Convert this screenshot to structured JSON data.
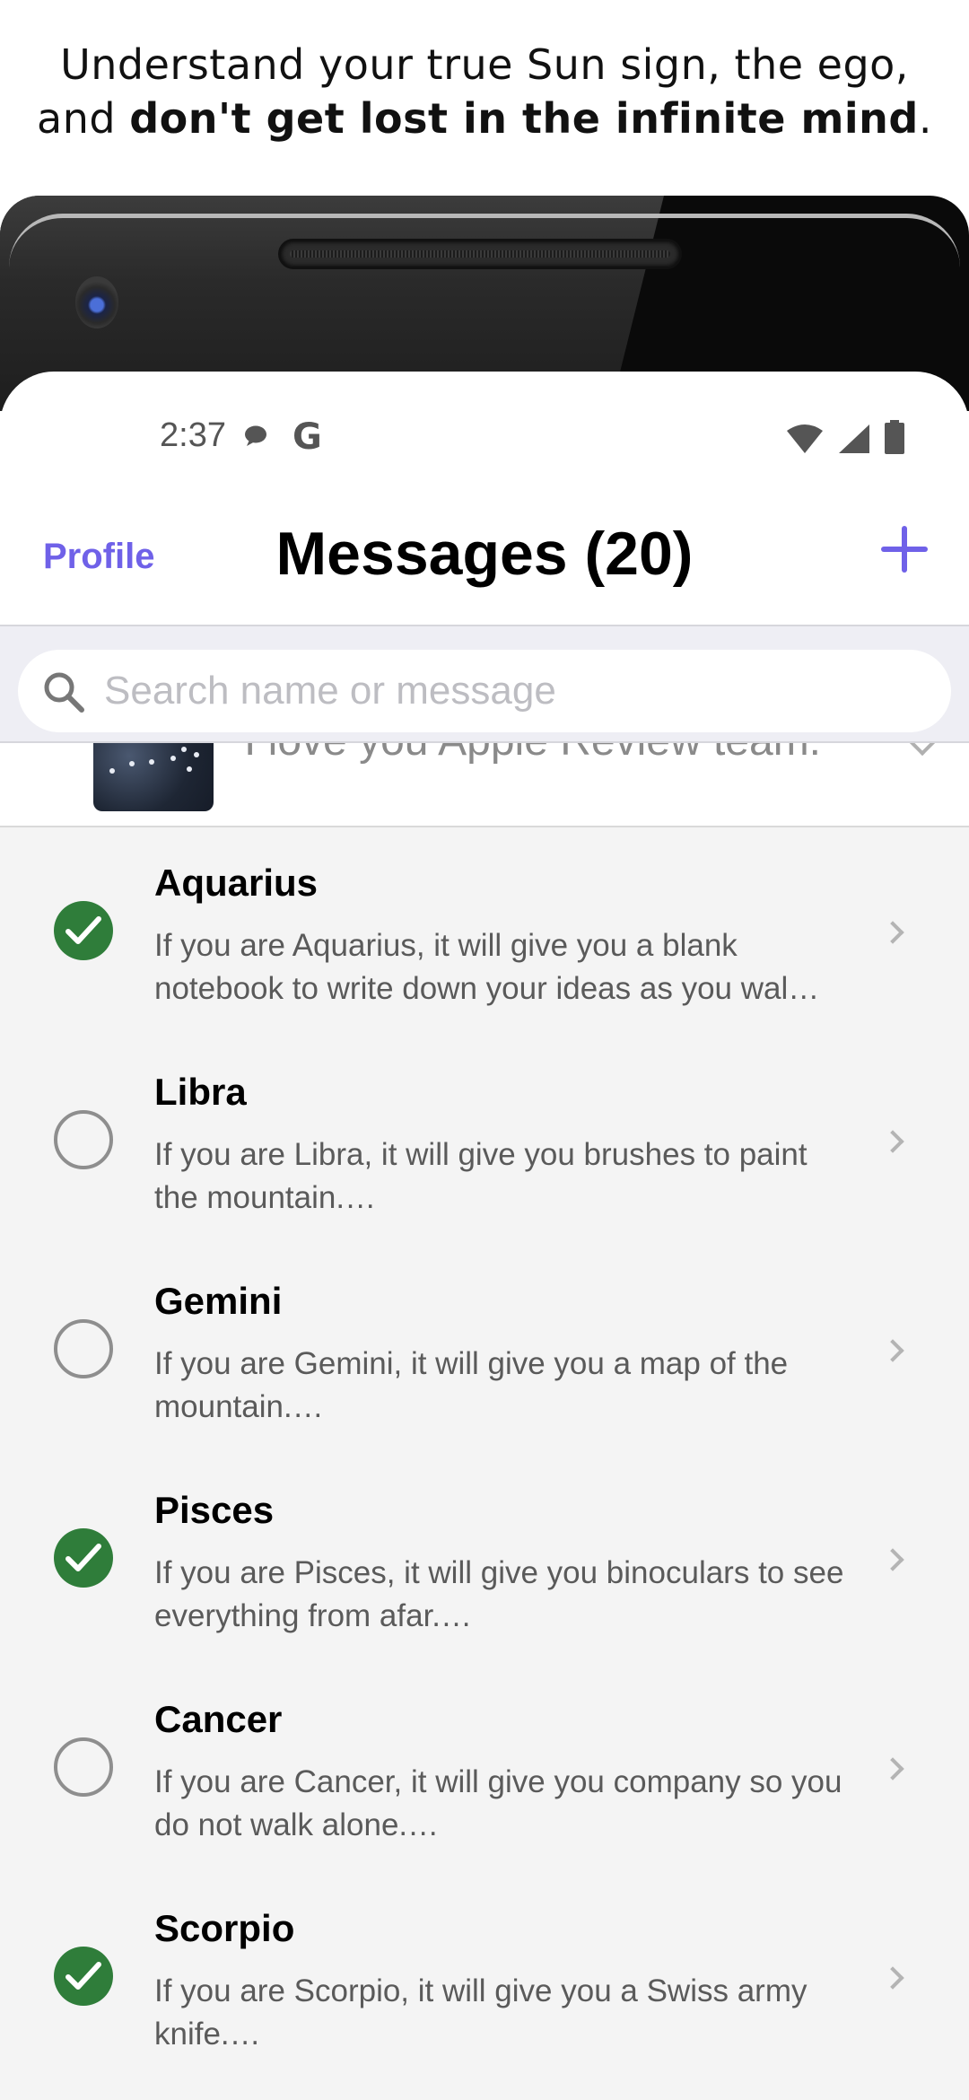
{
  "promo": {
    "line1": "Understand your true Sun sign, the ego,",
    "line2_prefix": "and ",
    "line2_bold": "don't get lost in the infinite mind",
    "line2_suffix": "."
  },
  "status_bar": {
    "time": "2:37",
    "g_label": "G",
    "icons": [
      "chat-bubble-icon",
      "google-icon",
      "wifi-icon",
      "cell-signal-icon",
      "battery-icon"
    ]
  },
  "nav": {
    "left_label": "Profile",
    "title": "Messages (20)",
    "add_icon": "plus-icon"
  },
  "search": {
    "placeholder": "Search name or message",
    "icon": "search-icon"
  },
  "pinned": {
    "preview": "I love you Apple Review team."
  },
  "messages": [
    {
      "title": "Aquarius",
      "preview": "If you are Aquarius, it will give you a blank notebook to write down your ideas as you wal…",
      "checked": true
    },
    {
      "title": "Libra",
      "preview": "If you are Libra, it will give you brushes to paint the mountain.…",
      "checked": false
    },
    {
      "title": "Gemini",
      "preview": "If you are Gemini, it will give you a map of the mountain.…",
      "checked": false
    },
    {
      "title": "Pisces",
      "preview": "If you are Pisces, it will give you binoculars to see everything from afar.…",
      "checked": true
    },
    {
      "title": "Cancer",
      "preview": "If you are Cancer, it will give you company so you do not walk alone.…",
      "checked": false
    },
    {
      "title": "Scorpio",
      "preview": "If you are Scorpio, it will give you a Swiss army knife.…",
      "checked": true
    }
  ],
  "colors": {
    "accent": "#6f61e8",
    "check_done": "#2f7d3a",
    "list_bg": "#f4f4f4"
  }
}
